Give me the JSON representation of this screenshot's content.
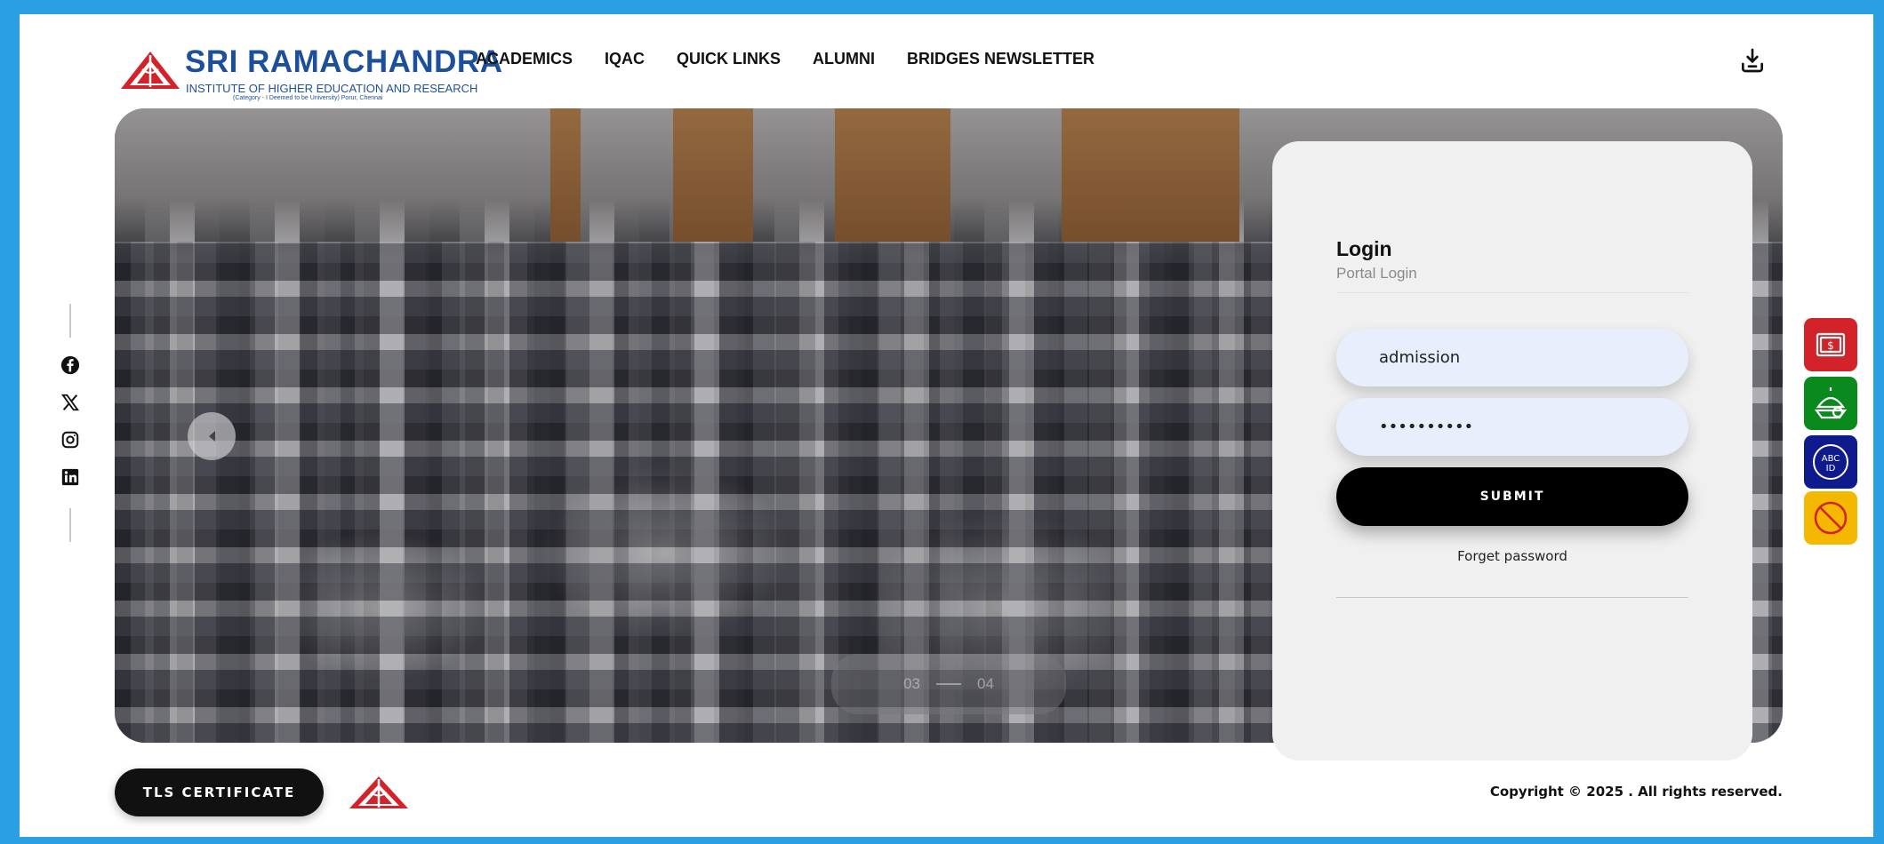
{
  "brand": {
    "name": "SRI RAMACHANDRA",
    "subtitle": "INSTITUTE OF HIGHER EDUCATION AND RESEARCH",
    "tagline": "(Category - I Deemed to be University) Porur, Chennai",
    "primary_color": "#1c4f9c",
    "emblem_color": "#d2232a"
  },
  "nav": {
    "items": [
      "ACADEMICS",
      "IQAC",
      "QUICK LINKS",
      "ALUMNI",
      "BRIDGES NEWSLETTER"
    ]
  },
  "header": {
    "download_icon": "download-icon"
  },
  "social": {
    "icons": [
      "facebook-icon",
      "x-icon",
      "instagram-icon",
      "linkedin-icon"
    ]
  },
  "hero": {
    "slider": {
      "current": "03",
      "total": "04"
    }
  },
  "login": {
    "title": "Login",
    "subtitle": "Portal Login",
    "username_value": "admission",
    "password_value": "••••••••••",
    "submit_label": "SUBMIT",
    "forget_label": "Forget password"
  },
  "side_buttons": [
    {
      "icon": "fee-payment-icon",
      "color": "#d2232a"
    },
    {
      "icon": "scholarship-icon",
      "color": "#0a8a1d"
    },
    {
      "icon": "abc-id-icon",
      "label": "ABC ID",
      "color": "#0f1a8c"
    },
    {
      "icon": "anti-ragging-icon",
      "color": "#f5b800"
    }
  ],
  "footer": {
    "tls_label": "TLS CERTIFICATE",
    "copyright": "Copyright © 2025 . All rights reserved."
  }
}
